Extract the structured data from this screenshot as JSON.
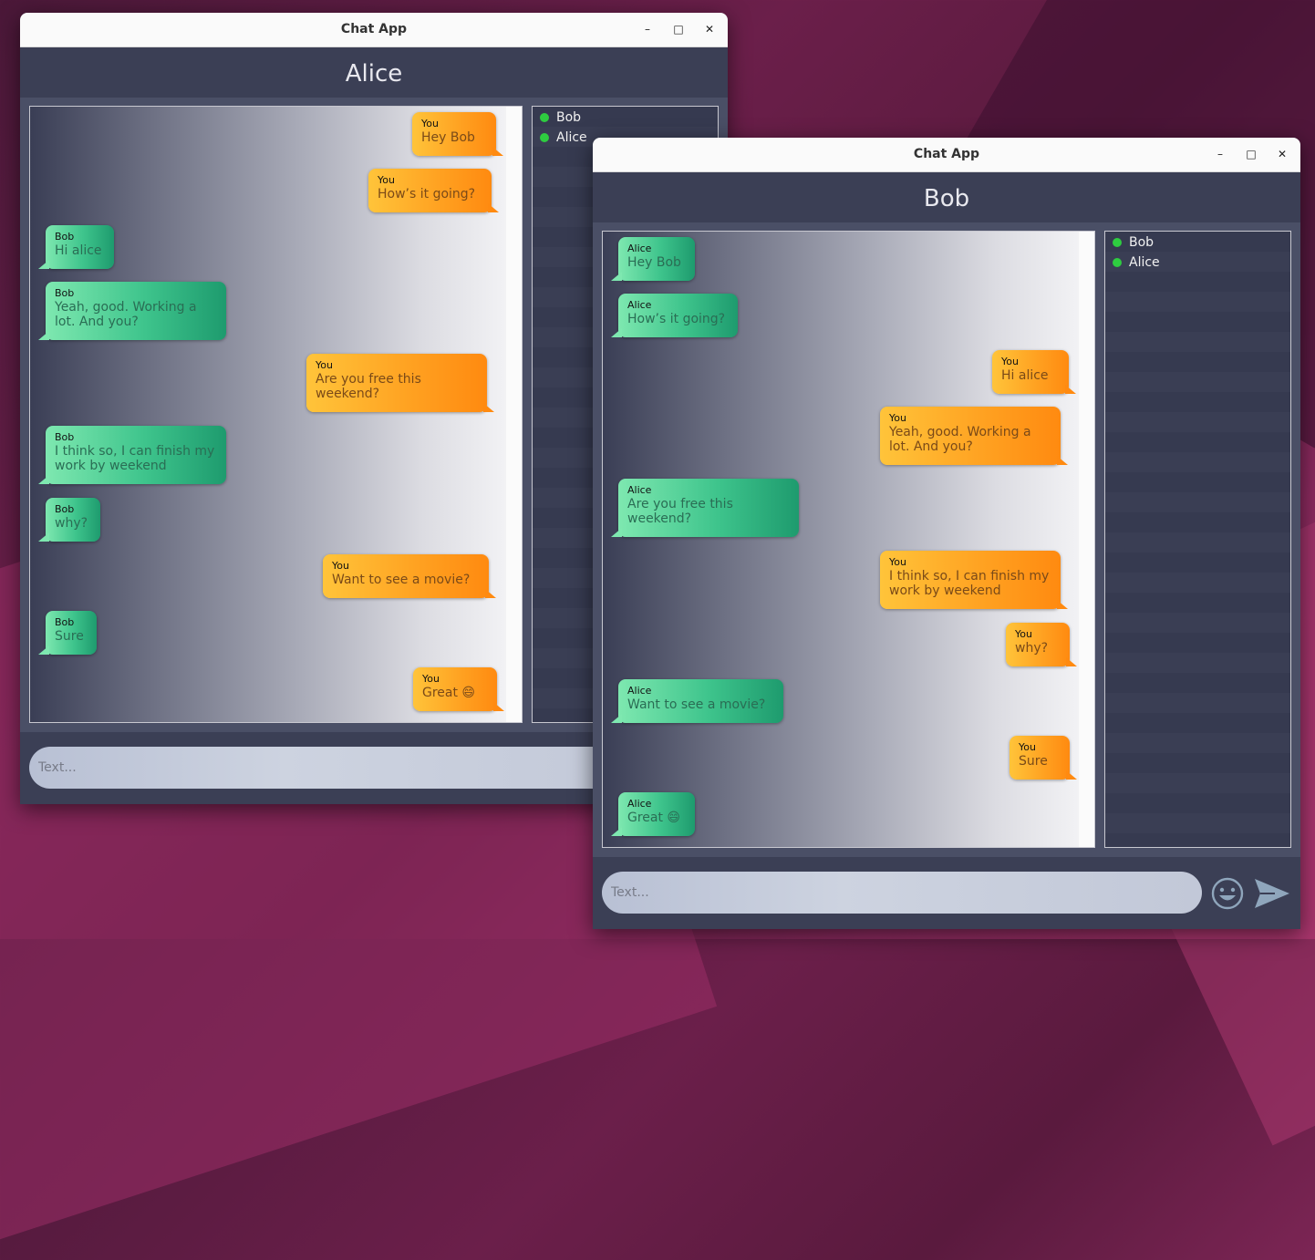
{
  "app_title": "Chat App",
  "window_controls": {
    "minimize": "–",
    "maximize": "□",
    "close": "✕"
  },
  "placeholder": "Text...",
  "icons": {
    "emoji": "emoji-icon",
    "send": "send-icon"
  },
  "colors": {
    "online": "#2ecc40",
    "outgoing": "#ffa020",
    "incoming": "#3ec48c"
  },
  "alice_window": {
    "header": "Alice",
    "users": [
      "Bob",
      "Alice"
    ],
    "messages": [
      {
        "who": "You",
        "text": "Hey Bob"
      },
      {
        "who": "You",
        "text": "How’s it going?"
      },
      {
        "who": "Bob",
        "text": "Hi alice"
      },
      {
        "who": "Bob",
        "text": "Yeah, good. Working a lot. And you?"
      },
      {
        "who": "You",
        "text": "Are you free this weekend?"
      },
      {
        "who": "Bob",
        "text": "I think so, I can finish my work by weekend"
      },
      {
        "who": "Bob",
        "text": "why?"
      },
      {
        "who": "You",
        "text": "Want to see a movie?"
      },
      {
        "who": "Bob",
        "text": "Sure"
      },
      {
        "who": "You",
        "text": "Great 😄"
      }
    ]
  },
  "bob_window": {
    "header": "Bob",
    "users": [
      "Bob",
      "Alice"
    ],
    "messages": [
      {
        "who": "Alice",
        "text": "Hey Bob"
      },
      {
        "who": "Alice",
        "text": "How’s it going?"
      },
      {
        "who": "You",
        "text": "Hi alice"
      },
      {
        "who": "You",
        "text": "Yeah, good. Working a lot. And you?"
      },
      {
        "who": "Alice",
        "text": "Are you free this weekend?"
      },
      {
        "who": "You",
        "text": "I think so, I can finish my work by weekend"
      },
      {
        "who": "You",
        "text": "why?"
      },
      {
        "who": "Alice",
        "text": "Want to see a movie?"
      },
      {
        "who": "You",
        "text": "Sure"
      },
      {
        "who": "Alice",
        "text": "Great 😄"
      }
    ]
  }
}
